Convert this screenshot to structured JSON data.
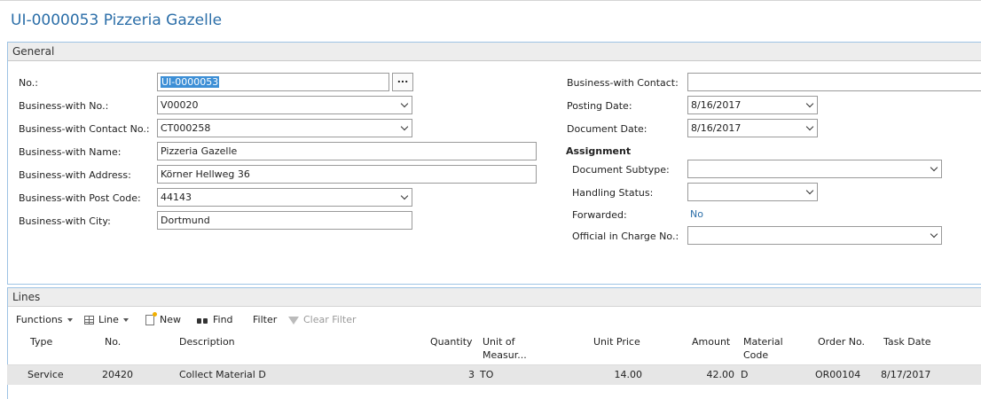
{
  "page_title": "UI-0000053 Pizzeria Gazelle",
  "general": {
    "header": "General",
    "fields": {
      "no": {
        "label": "No.:",
        "value": "UI-0000053"
      },
      "bw_no": {
        "label": "Business-with No.:",
        "value": "V00020"
      },
      "bw_contact_no": {
        "label": "Business-with Contact No.:",
        "value": "CT000258"
      },
      "bw_name": {
        "label": "Business-with Name:",
        "value": "Pizzeria Gazelle"
      },
      "bw_address": {
        "label": "Business-with Address:",
        "value": "Körner Hellweg 36"
      },
      "bw_post_code": {
        "label": "Business-with Post Code:",
        "value": "44143"
      },
      "bw_city": {
        "label": "Business-with City:",
        "value": "Dortmund"
      },
      "bw_contact": {
        "label": "Business-with Contact:",
        "value": ""
      },
      "posting_date": {
        "label": "Posting Date:",
        "value": "8/16/2017"
      },
      "document_date": {
        "label": "Document Date:",
        "value": "8/16/2017"
      }
    },
    "assist_button": "...",
    "assignment": {
      "header": "Assignment",
      "document_subtype": {
        "label": "Document Subtype:",
        "value": ""
      },
      "handling_status": {
        "label": "Handling Status:",
        "value": ""
      },
      "forwarded": {
        "label": "Forwarded:",
        "value": "No"
      },
      "official_in_charge": {
        "label": "Official in Charge No.:",
        "value": ""
      }
    }
  },
  "lines": {
    "header": "Lines",
    "toolbar": {
      "functions": "Functions",
      "line": "Line",
      "new": "New",
      "find": "Find",
      "filter": "Filter",
      "clear_filter": "Clear Filter"
    },
    "columns": {
      "type": "Type",
      "no": "No.",
      "description": "Description",
      "quantity": "Quantity",
      "unit_1": "Unit of",
      "unit_2": "Measur...",
      "unit_price": "Unit Price",
      "amount": "Amount",
      "material_1": "Material",
      "material_2": "Code",
      "order_no": "Order No.",
      "task_date": "Task Date"
    },
    "rows": [
      {
        "type": "Service",
        "no": "20420",
        "description": "Collect Material D",
        "quantity": "3",
        "unit": "TO",
        "unit_price": "14.00",
        "amount": "42.00",
        "material_code": "D",
        "order_no": "OR00104",
        "task_date": "8/17/2017"
      }
    ]
  },
  "colors": {
    "title": "#2b6ea8",
    "selection": "#3d8fd6",
    "tab_border": "#9ec3e4",
    "row_bg": "#e6e6e6"
  }
}
